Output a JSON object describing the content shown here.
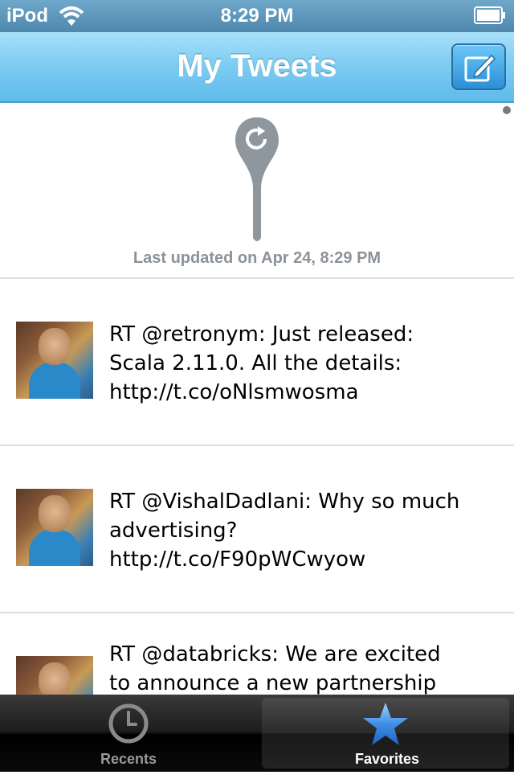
{
  "status_bar": {
    "carrier": "iPod",
    "time": "8:29 PM",
    "icons": [
      "wifi-icon",
      "battery-icon"
    ]
  },
  "nav": {
    "title": "My Tweets",
    "compose_icon": "compose-icon"
  },
  "refresh": {
    "icon": "refresh-icon",
    "last_updated": "Last updated on Apr 24, 8:29 PM"
  },
  "tweets": [
    {
      "lines": [
        "RT @retronym: Just released:",
        "Scala 2.11.0. All the details:",
        "http://t.co/oNlsmwosma"
      ]
    },
    {
      "lines": [
        "RT @VishalDadlani: Why so much",
        "advertising?",
        "http://t.co/F90pWCwyow"
      ]
    },
    {
      "lines": [
        "RT @databricks: We are excited",
        "to announce a new partnership"
      ]
    }
  ],
  "tabs": [
    {
      "label": "Recents",
      "icon": "clock-icon",
      "selected": false
    },
    {
      "label": "Favorites",
      "icon": "star-icon",
      "selected": true
    }
  ],
  "colors": {
    "nav_bar": "#7fcdf3",
    "status_bar": "#5b93b7",
    "star": "#3f8ee6",
    "muted_text": "#8b929a"
  }
}
